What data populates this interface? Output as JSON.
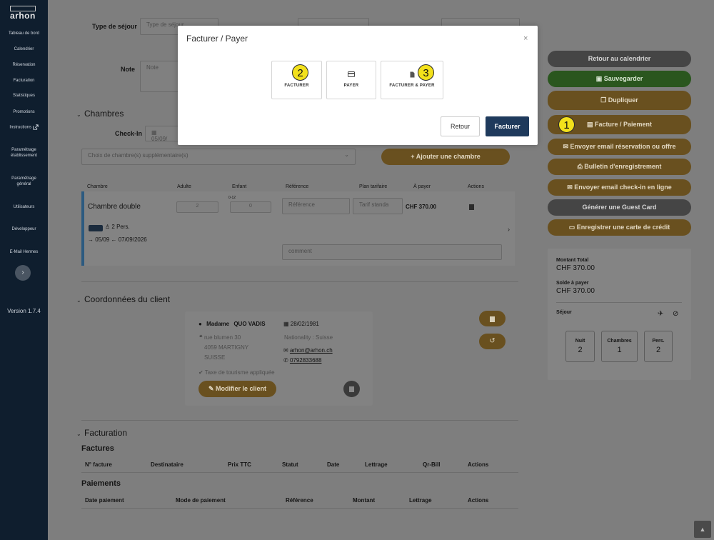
{
  "app": {
    "logo_text": "arhon",
    "version": "Version 1.7.4"
  },
  "sidebar": {
    "items": [
      {
        "label": "Tableau de bord"
      },
      {
        "label": "Calendrier"
      },
      {
        "label": "Réservation"
      },
      {
        "label": "Facturation"
      },
      {
        "label": "Statistiques"
      },
      {
        "label": "Promotions"
      },
      {
        "label": "Instructions"
      },
      {
        "label_line1": "Paramétrage",
        "label_line2": "établissement"
      },
      {
        "label_line1": "Paramétrage",
        "label_line2": "général"
      },
      {
        "label": "Utilisateurs"
      },
      {
        "label": "Développeur"
      },
      {
        "label": "E-Mail Hermes"
      }
    ],
    "toggle_icon": "chevron-right-icon"
  },
  "form": {
    "type_sejour_label": "Type de séjour",
    "type_sejour_placeholder": "Type de séjour",
    "note_label": "Note",
    "note_placeholder": "Note"
  },
  "chambres": {
    "title": "Chambres",
    "checkin_label": "Check-In",
    "checkin_value": "05/09/",
    "select_placeholder": "Choix de chambre(s) supplémentaire(s)",
    "add_button": "Ajouter une chambre",
    "columns": [
      "Chambre",
      "Adulte",
      "Enfant",
      "Référence",
      "Plan tarifaire",
      "À payer",
      "Actions"
    ],
    "row": {
      "name": "Chambre double",
      "adults": "2",
      "age_range": "0-12",
      "children": "0",
      "reference_placeholder": "Référence",
      "plan": "Tarif standa",
      "amount": "CHF 370.00",
      "persons": "2 Pers.",
      "dates": "05/09 ← 07/09/2026",
      "comment_placeholder": "comment"
    }
  },
  "client": {
    "title": "Coordonnées du client",
    "salutation": "Madame",
    "name": "QUO VADIS",
    "birthdate": "28/02/1981",
    "address1": "rue blumen 30",
    "address2": "4059 MARTIGNY",
    "country": "SUISSE",
    "nationality": "Nationality : Suisse",
    "email": "arhon@arhon.ch",
    "phone": "0792833688",
    "tax_note": "Taxe de tourisme appliquée",
    "edit_button": "Modifier le client"
  },
  "facturation": {
    "title": "Facturation",
    "factures_title": "Factures",
    "factures_columns": [
      "N° facture",
      "Destinataire",
      "Prix TTC",
      "Statut",
      "Date",
      "Lettrage",
      "Qr-Bill",
      "Actions"
    ],
    "paiements_title": "Paiements",
    "paiements_columns": [
      "Date paiement",
      "Mode de paiement",
      "Référence",
      "Montant",
      "Lettrage",
      "Actions"
    ]
  },
  "side_actions": {
    "retour_calendrier": "Retour au calendrier",
    "sauvegarder": "Sauvegarder",
    "dupliquer": "Dupliquer",
    "facture_paiement": "Facture / Paiement",
    "envoyer_email_reservation": "Envoyer email réservation ou offre",
    "bulletin": "Bulletin d'enregistrement",
    "envoyer_email_checkin": "Envoyer email check-in en ligne",
    "guest_card": "Générer une Guest Card",
    "carte_credit": "Enregistrer une carte de crédit"
  },
  "summary": {
    "montant_total_label": "Montant Total",
    "montant_total_value": "CHF 370.00",
    "solde_label": "Solde à payer",
    "solde_value": "CHF 370.00",
    "sejour_label": "Séjour",
    "stats": [
      {
        "label": "Nuit",
        "value": "2"
      },
      {
        "label": "Chambres",
        "value": "1"
      },
      {
        "label": "Pers.",
        "value": "2"
      }
    ]
  },
  "modal": {
    "title": "Facturer / Payer",
    "options": [
      {
        "label": "FACTURER",
        "icon": ""
      },
      {
        "label": "PAYER",
        "icon": "credit-card-icon"
      },
      {
        "label": "FACTURER & PAYER",
        "icon": "document-icon"
      }
    ],
    "retour_button": "Retour",
    "facturer_button": "Facturer"
  },
  "annotations": {
    "badge1": "1",
    "badge2": "2",
    "badge3": "3"
  },
  "colors": {
    "accent_gold": "#c9a04a",
    "accent_green": "#5aa84a",
    "modal_primary": "#1f3a5c",
    "badge_yellow": "#f3e11b"
  }
}
